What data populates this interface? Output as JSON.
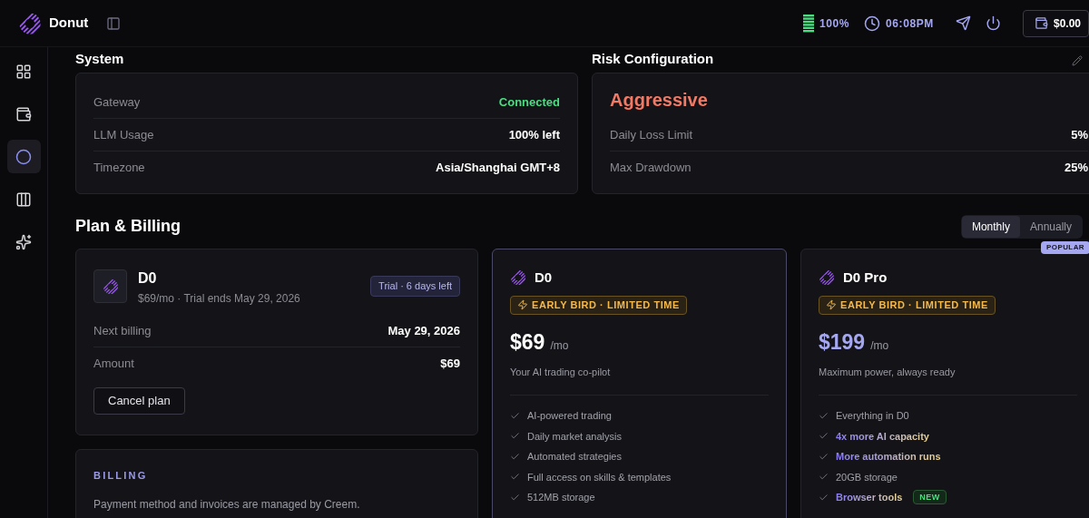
{
  "header": {
    "brand": "Donut",
    "battery": "100%",
    "time": "06:08PM",
    "wallet": "$0.00"
  },
  "sidebar": {
    "items": [
      {
        "selected": false
      },
      {
        "selected": false
      },
      {
        "selected": true
      },
      {
        "selected": false
      },
      {
        "selected": false
      }
    ]
  },
  "system": {
    "title": "System",
    "rows": [
      {
        "label": "Gateway",
        "value": "Connected",
        "kind": "status"
      },
      {
        "label": "LLM Usage",
        "value": "100% left",
        "kind": "plain"
      },
      {
        "label": "Timezone",
        "value": "Asia/Shanghai GMT+8",
        "kind": "plain"
      }
    ]
  },
  "risk": {
    "title": "Risk Configuration",
    "profile": "Aggressive",
    "rows": [
      {
        "label": "Daily Loss Limit",
        "value": "5%"
      },
      {
        "label": "Max Drawdown",
        "value": "25%"
      }
    ]
  },
  "billing": {
    "title": "Plan & Billing",
    "periods": [
      {
        "label": "Monthly",
        "selected": true
      },
      {
        "label": "Annually",
        "selected": false
      }
    ],
    "current": {
      "name": "D0",
      "subtitle": "$69/mo · Trial ends May 29, 2026",
      "badge": "Trial · 6 days left",
      "rows": [
        {
          "label": "Next billing",
          "value": "May 29, 2026"
        },
        {
          "label": "Amount",
          "value": "$69"
        }
      ],
      "cancel": "Cancel plan"
    },
    "note": {
      "heading": "BILLING",
      "text": "Payment method and invoices are managed by Creem."
    },
    "plans": [
      {
        "name": "D0",
        "promo": "EARLY BIRD · LIMITED TIME",
        "price": "$69",
        "unit": "/mo",
        "tagline": "Your AI trading co-pilot",
        "selected": true,
        "accent": false,
        "features": [
          {
            "text": "AI-powered trading",
            "highlight": false
          },
          {
            "text": "Daily market analysis",
            "highlight": false
          },
          {
            "text": "Automated strategies",
            "highlight": false
          },
          {
            "text": "Full access on skills & templates",
            "highlight": false
          },
          {
            "text": "512MB storage",
            "highlight": false
          }
        ]
      },
      {
        "name": "D0 Pro",
        "promo": "EARLY BIRD · LIMITED TIME",
        "price": "$199",
        "unit": "/mo",
        "tagline": "Maximum power, always ready",
        "selected": false,
        "accent": true,
        "ribbon": "POPULAR",
        "features": [
          {
            "text": "Everything in D0",
            "highlight": false
          },
          {
            "text": "4x more AI capacity",
            "highlight": true
          },
          {
            "text": "More automation runs",
            "highlight": true
          },
          {
            "text": "20GB storage",
            "highlight": false
          },
          {
            "text": "Browser tools",
            "highlight": true,
            "badge": "NEW"
          }
        ]
      }
    ]
  }
}
